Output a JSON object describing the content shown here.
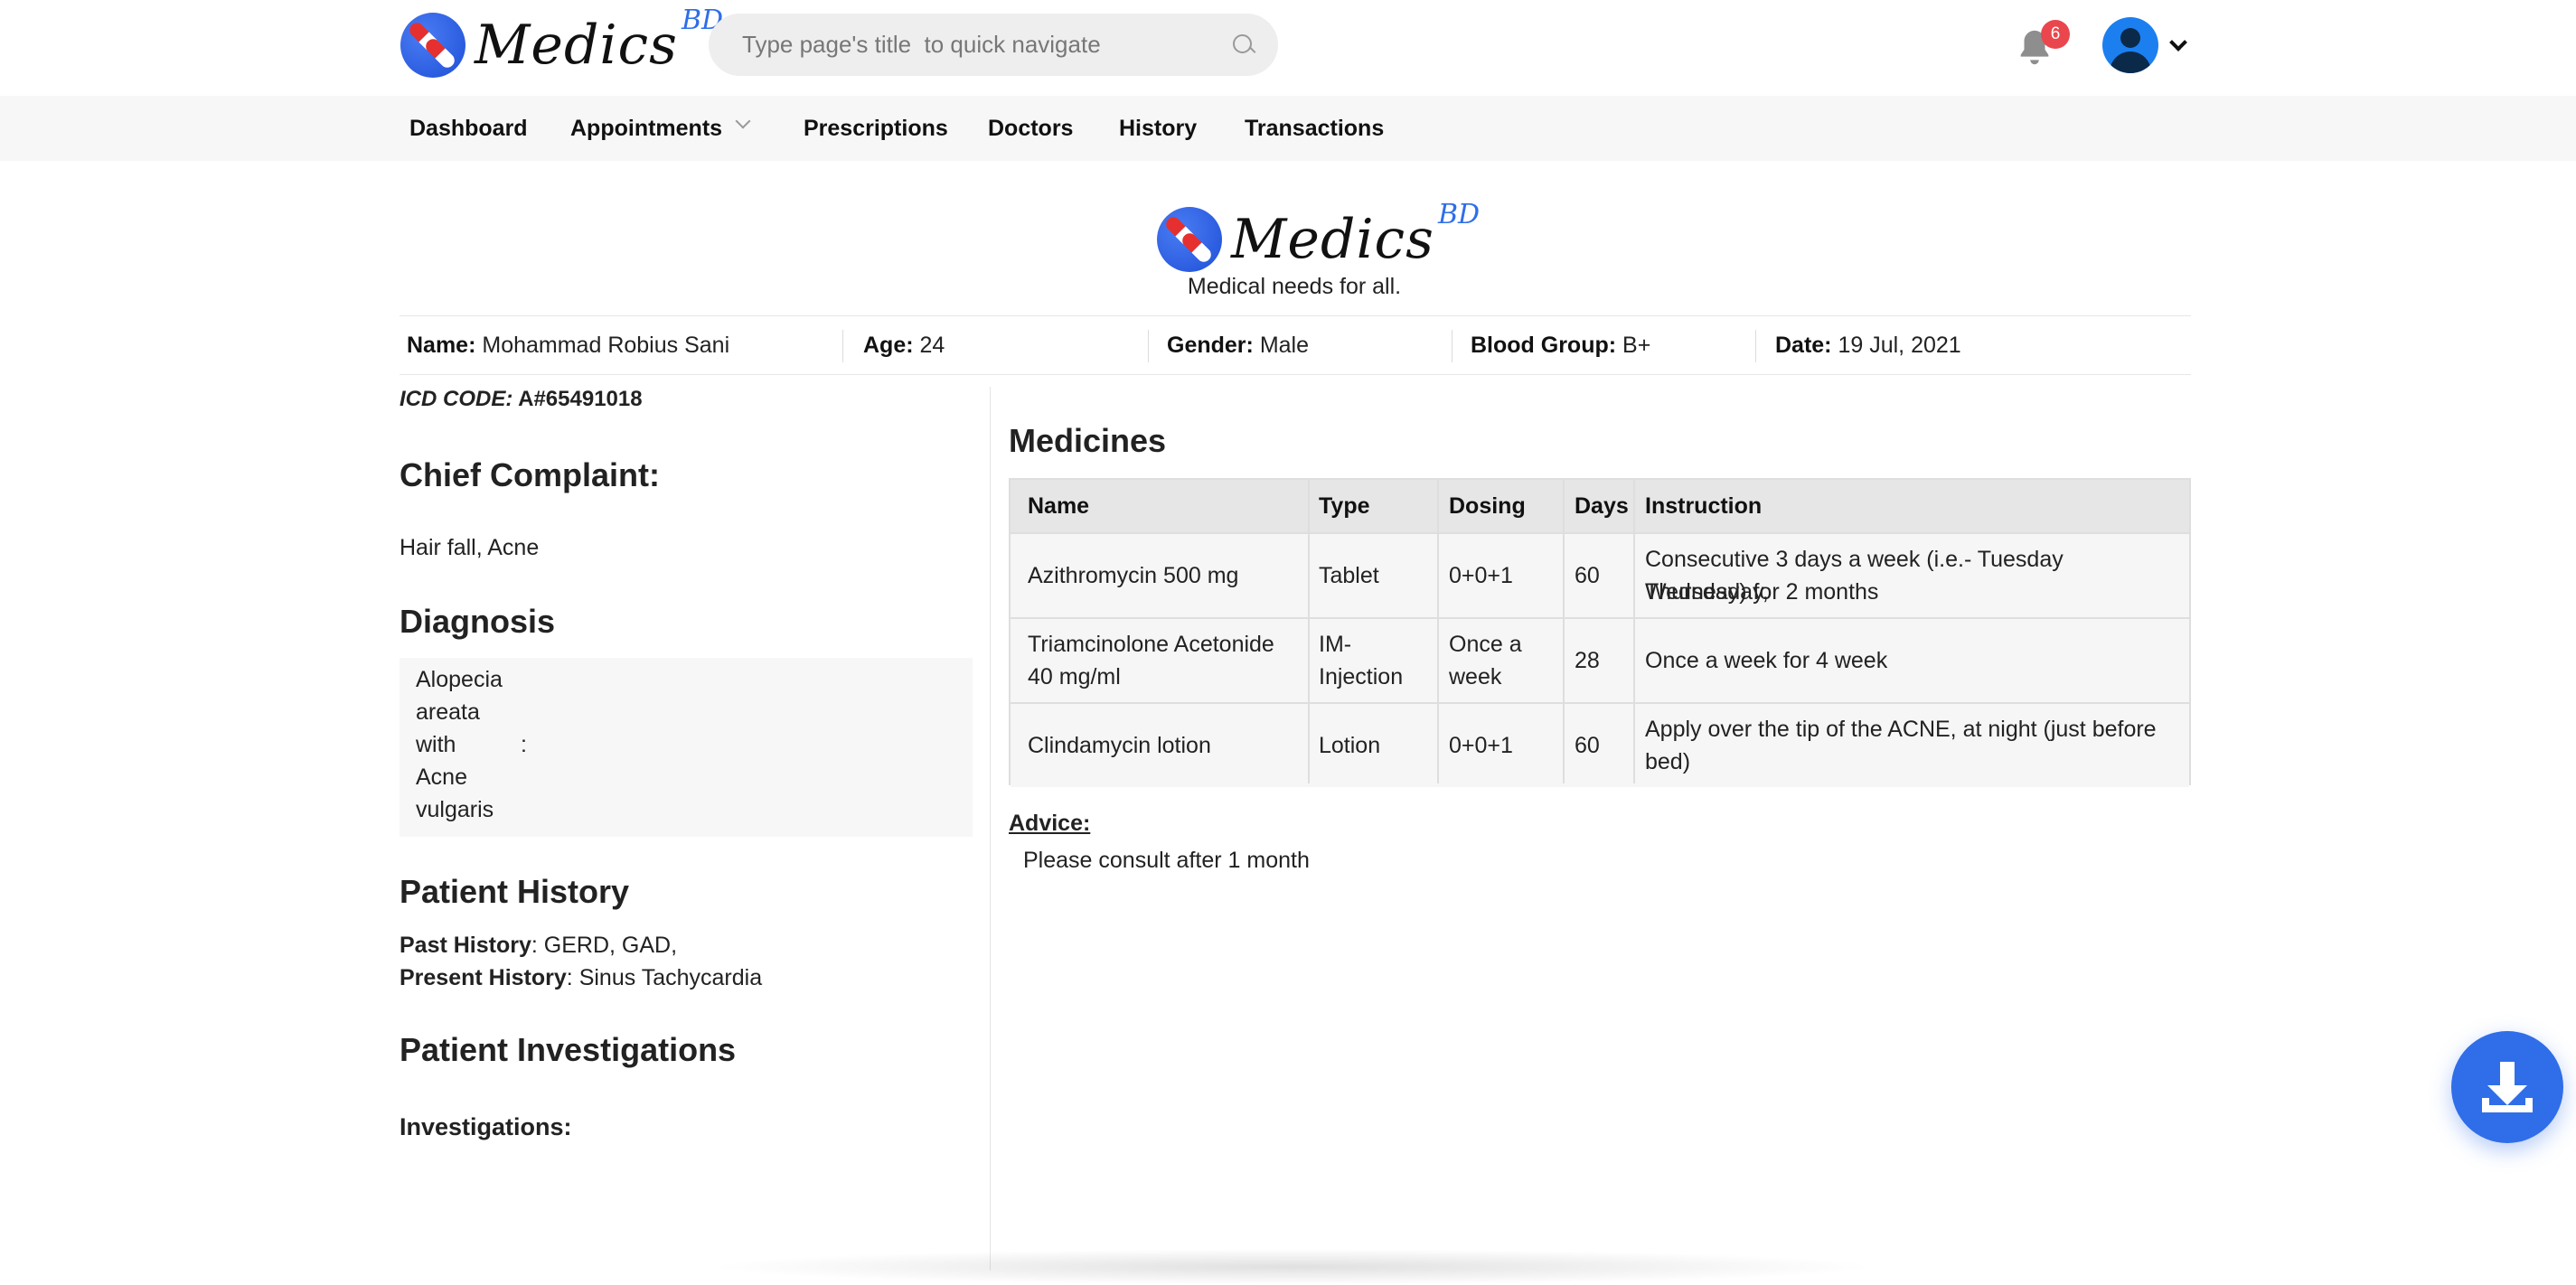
{
  "brand": {
    "name": "Medics",
    "suffix": "BD",
    "tagline": "Medical needs for all."
  },
  "search": {
    "placeholder": "Type page's title  to quick navigate"
  },
  "notifications": {
    "count": "6"
  },
  "nav": {
    "items": [
      {
        "label": "Dashboard"
      },
      {
        "label": "Appointments"
      },
      {
        "label": "Prescriptions"
      },
      {
        "label": "Doctors"
      },
      {
        "label": "History"
      },
      {
        "label": "Transactions"
      }
    ]
  },
  "patient": {
    "name_label": "Name:",
    "name": "Mohammad Robius Sani",
    "age_label": "Age:",
    "age": "24",
    "gender_label": "Gender:",
    "gender": "Male",
    "blood_label": "Blood Group:",
    "blood": "B+",
    "date_label": "Date:",
    "date": "19 Jul, 2021"
  },
  "icd": {
    "label": "ICD CODE:",
    "code": "A#65491018"
  },
  "chief_complaint": {
    "title": "Chief Complaint:",
    "text": "Hair fall, Acne"
  },
  "diagnosis": {
    "title": "Diagnosis",
    "lines": [
      "Alopecia",
      "areata",
      "with",
      "Acne",
      "vulgaris"
    ],
    "colon": ":"
  },
  "patient_history": {
    "title": "Patient History",
    "past_label": "Past History",
    "past": ": GERD, GAD,",
    "present_label": "Present History",
    "present": ": Sinus Tachycardia"
  },
  "investigations": {
    "title": "Patient Investigations",
    "label": "Investigations:"
  },
  "medicines": {
    "title": "Medicines",
    "headers": [
      "Name",
      "Type",
      "Dosing",
      "Days",
      "Instruction"
    ],
    "rows": [
      {
        "name": [
          "Azithromycin 500 mg"
        ],
        "type": [
          "Tablet"
        ],
        "dosing": [
          "0+0+1"
        ],
        "days": "60",
        "instruction": [
          "Consecutive 3 days a week (i.e.- Tuesday Wednesday,",
          "Thursday) for 2 months"
        ]
      },
      {
        "name": [
          "Triamcinolone Acetonide",
          "40 mg/ml"
        ],
        "type": [
          "IM-",
          "Injection"
        ],
        "dosing": [
          "Once a",
          "week"
        ],
        "days": "28",
        "instruction": [
          "Once a week for 4 week"
        ]
      },
      {
        "name": [
          "Clindamycin lotion"
        ],
        "type": [
          "Lotion"
        ],
        "dosing": [
          "0+0+1"
        ],
        "days": "60",
        "instruction": [
          "Apply over the tip of the ACNE, at night (just before",
          "bed)"
        ]
      }
    ]
  },
  "advice": {
    "label": "Advice:",
    "text": "Please consult after 1 month"
  },
  "colors": {
    "accent": "#2f6ee8",
    "badge": "#e9474d",
    "nav_bg": "#f7f7f7"
  }
}
